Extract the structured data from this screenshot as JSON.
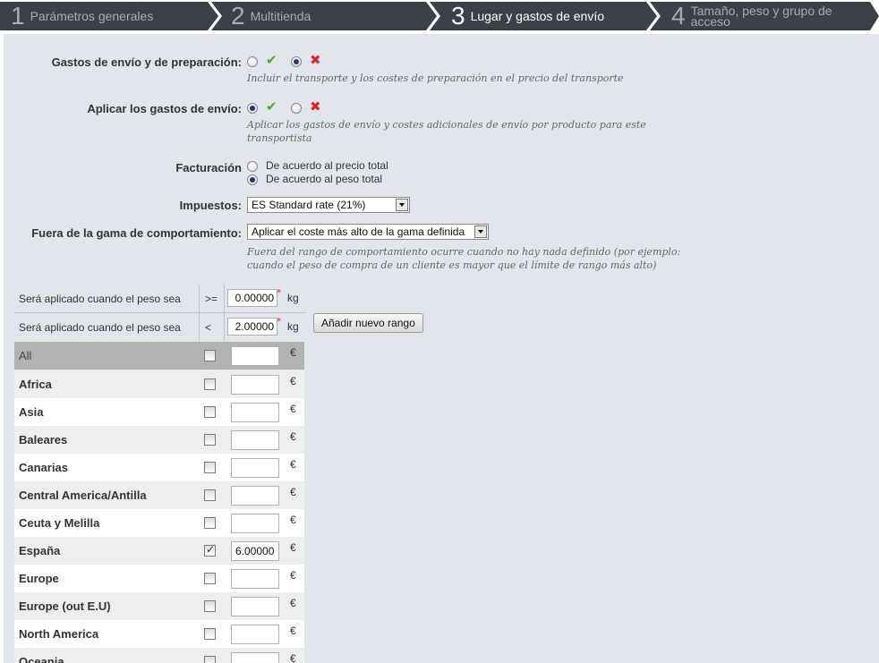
{
  "steps": [
    {
      "num": "1",
      "label": "Parámetros generales",
      "state": "done"
    },
    {
      "num": "2",
      "label": "Multitienda",
      "state": "done"
    },
    {
      "num": "3",
      "label": "Lugar y gastos de envío",
      "state": "active"
    },
    {
      "num": "4",
      "label": "Tamaño, peso y grupo de acceso",
      "state": "pending"
    }
  ],
  "form": {
    "handling": {
      "label": "Gastos de envío y de preparación:",
      "selected": "no",
      "yes_icon": "check-icon",
      "no_icon": "cross-icon",
      "hint": "Incluir el transporte y los costes de preparación en el precio del transporte"
    },
    "shipping_fees": {
      "label": "Aplicar los gastos de envío:",
      "selected": "yes",
      "yes_icon": "check-icon",
      "no_icon": "cross-icon",
      "hint_line1": "Aplicar los gastos de envío y costes adicionales de envío por producto para este",
      "hint_line2": "transportista"
    },
    "billing": {
      "label": "Facturación",
      "option1": "De acuerdo al precio total",
      "option2": "De acuerdo al peso total",
      "selected": "option2"
    },
    "tax": {
      "label": "Impuestos:",
      "value": "ES Standard rate (21%)"
    },
    "out_of_range": {
      "label": "Fuera de la gama de comportamiento:",
      "value": "Aplicar el coste más alto de la gama definida",
      "hint_line1": "Fuera del rango de comportamiento ocurre cuando no hay nada definido (por ejemplo:",
      "hint_line2": "cuando el peso de compra de un cliente es mayor que el límite de rango más alto)"
    }
  },
  "ranges": {
    "from_label": "Será aplicado cuando el peso sea",
    "from_op": ">=",
    "from_value": "0.00000",
    "to_label": "Será aplicado cuando el peso sea",
    "to_op": "<",
    "to_value": "2.00000",
    "required_mark": "*",
    "unit": "kg",
    "add_button": "Añadir nuevo rango"
  },
  "zones": {
    "currency": "€",
    "all_label": "All",
    "rows": [
      {
        "name": "Africa",
        "checked": false,
        "value": ""
      },
      {
        "name": "Asia",
        "checked": false,
        "value": ""
      },
      {
        "name": "Baleares",
        "checked": false,
        "value": ""
      },
      {
        "name": "Canarias",
        "checked": false,
        "value": ""
      },
      {
        "name": "Central America/Antilla",
        "checked": false,
        "value": ""
      },
      {
        "name": "Ceuta y Melilla",
        "checked": false,
        "value": ""
      },
      {
        "name": "España",
        "checked": true,
        "value": "6.00000"
      },
      {
        "name": "Europe",
        "checked": false,
        "value": ""
      },
      {
        "name": "Europe (out E.U)",
        "checked": false,
        "value": ""
      },
      {
        "name": "North America",
        "checked": false,
        "value": ""
      },
      {
        "name": "Oceania",
        "checked": false,
        "value": ""
      }
    ]
  },
  "colors": {
    "stepbar": "#3b4049",
    "panel": "#e2e5ec",
    "all_row": "#b2b2b2",
    "check": "#4ca72c",
    "cross": "#d9262b"
  }
}
